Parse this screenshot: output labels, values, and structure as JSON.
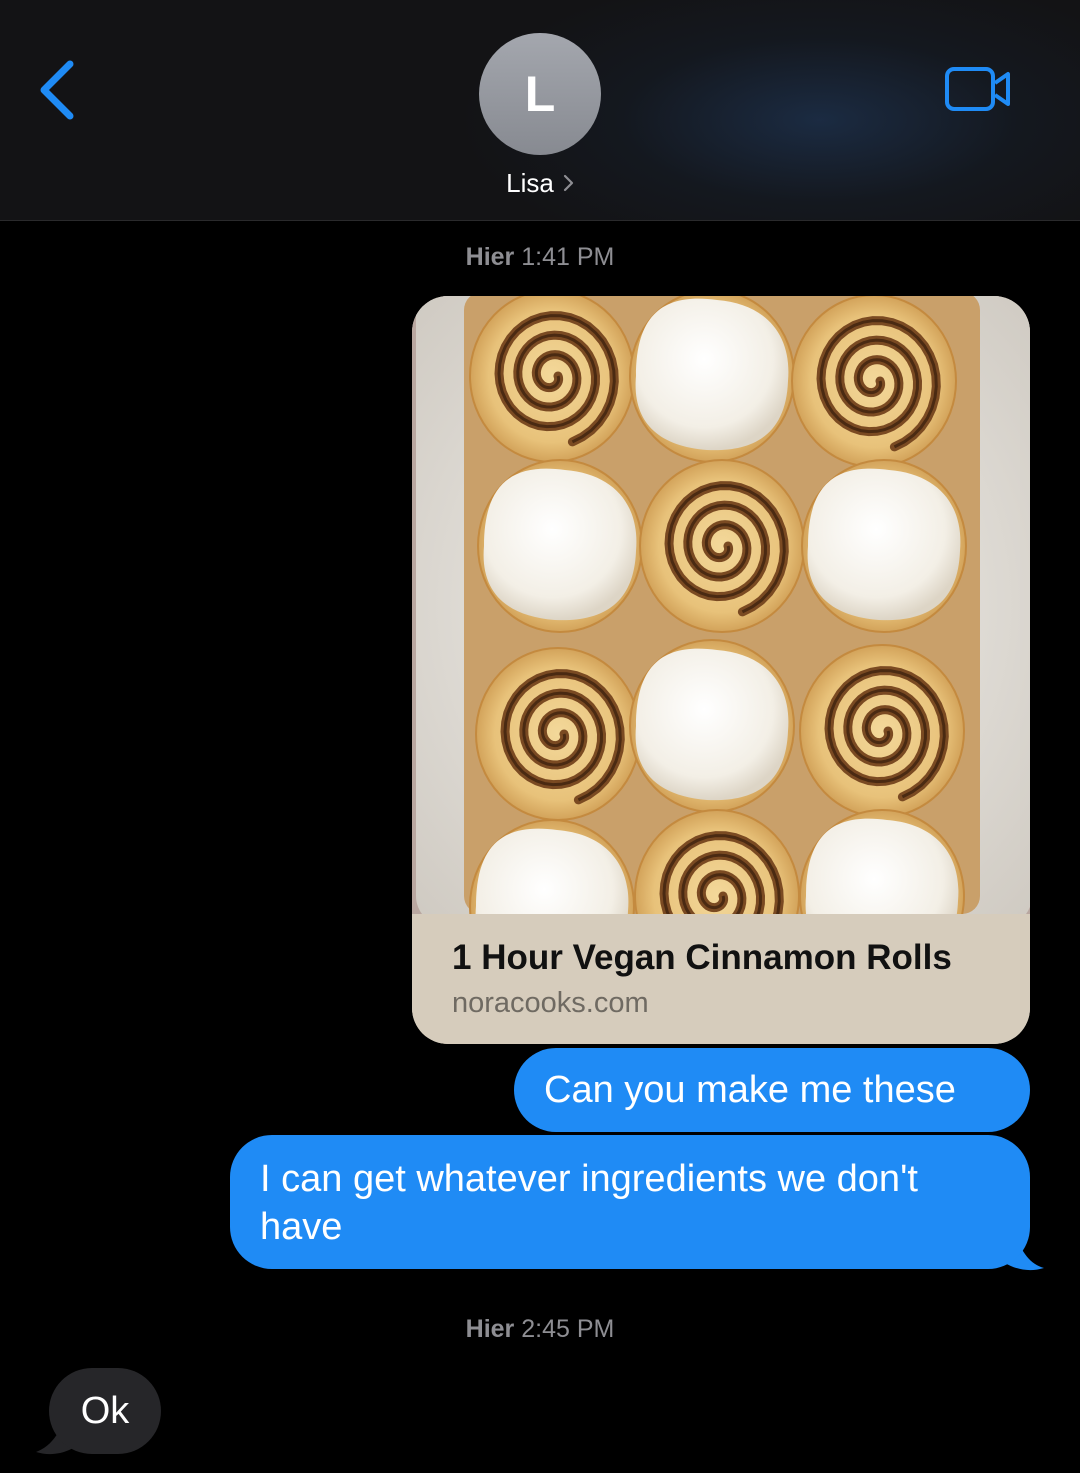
{
  "header": {
    "avatar_initial": "L",
    "contact_name": "Lisa",
    "back_icon": "chevron-left-icon",
    "video_icon": "video-camera-icon",
    "accent_color": "#1f8bf5"
  },
  "conversation": {
    "groups": [
      {
        "timestamp_day": "Hier",
        "timestamp_time": "1:41 PM",
        "link_preview": {
          "title": "1 Hour Vegan Cinnamon Rolls",
          "domain": "noracooks.com",
          "image_description": "cinnamon-rolls-photo"
        },
        "messages": [
          {
            "direction": "sent",
            "text": "Can you make me these"
          },
          {
            "direction": "sent",
            "text": "I can get whatever ingredients we don't have"
          }
        ]
      },
      {
        "timestamp_day": "Hier",
        "timestamp_time": "2:45 PM",
        "messages": [
          {
            "direction": "received",
            "text": "Ok"
          }
        ]
      }
    ]
  }
}
